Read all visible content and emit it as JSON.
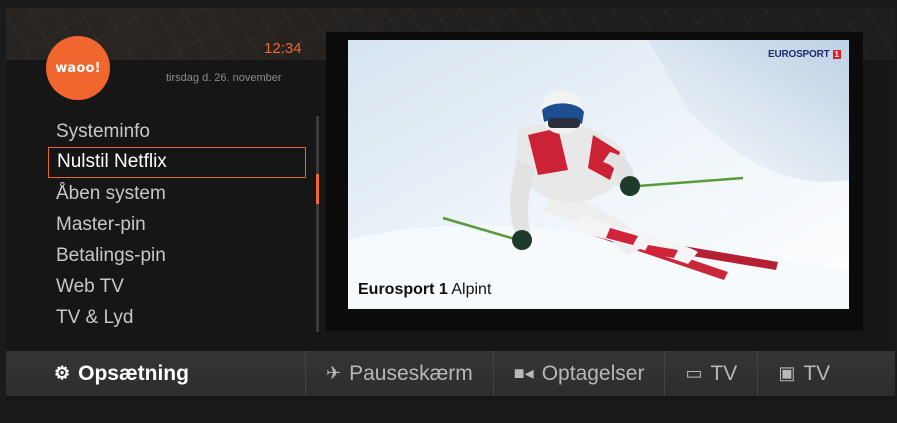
{
  "brand": {
    "logo_text": "waoo!",
    "accent": "#f0662e"
  },
  "header": {
    "time": "12:34",
    "date": "tirsdag d. 26. november"
  },
  "menu": {
    "items": [
      {
        "label": "Systeminfo"
      },
      {
        "label": "Nulstil Netflix"
      },
      {
        "label": "Åben system"
      },
      {
        "label": "Master-pin"
      },
      {
        "label": "Betalings-pin"
      },
      {
        "label": "Web TV"
      },
      {
        "label": "TV & Lyd"
      }
    ],
    "selected_index": 1
  },
  "preview": {
    "channel_logo": "EUROSPORT",
    "channel_logo_number": "1",
    "caption_channel": "Eurosport 1",
    "caption_program": "Alpint"
  },
  "navbar": {
    "items": [
      {
        "label": "Opsætning",
        "icon": "gears-icon",
        "active": true
      },
      {
        "label": "Pauseskærm",
        "icon": "screensaver-icon",
        "active": false
      },
      {
        "label": "Optagelser",
        "icon": "camera-icon",
        "active": false
      },
      {
        "label": "TV",
        "icon": "monitor-icon",
        "active": false
      },
      {
        "label": "TV",
        "icon": "tv-screen-icon",
        "active": false
      }
    ]
  }
}
